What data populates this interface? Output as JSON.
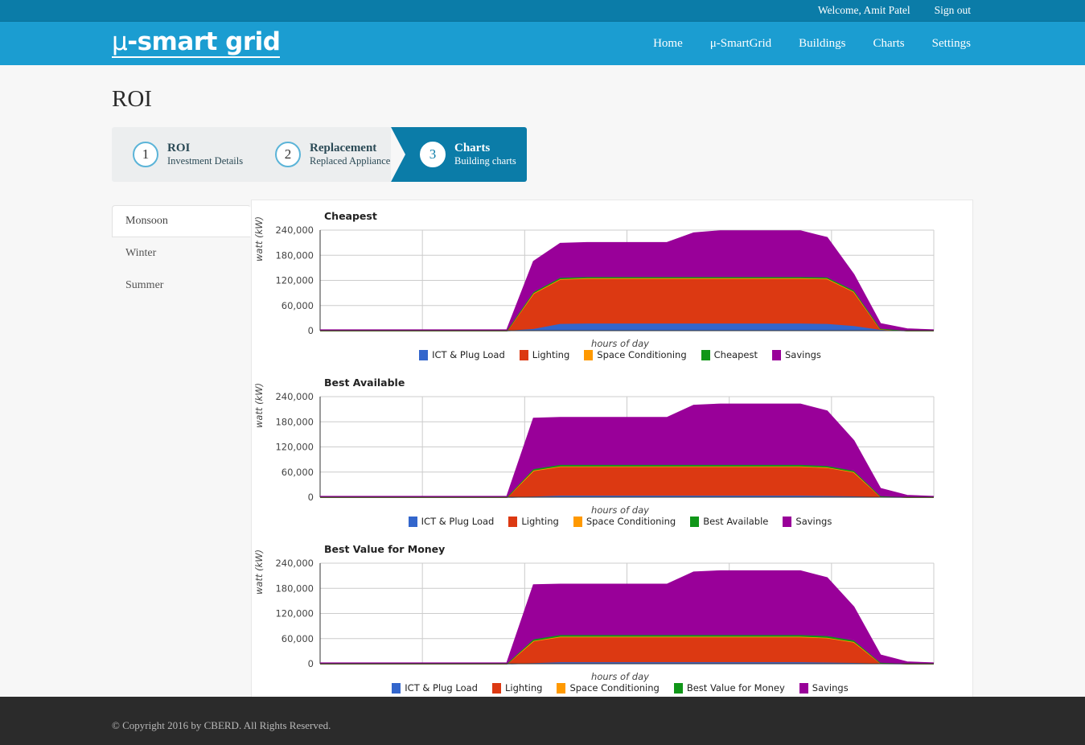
{
  "topbar": {
    "welcome": "Welcome, Amit Patel",
    "signout": "Sign out"
  },
  "brand": {
    "mu": "μ",
    "rest": "-smart grid"
  },
  "nav": [
    {
      "label": "Home"
    },
    {
      "label": "μ-SmartGrid"
    },
    {
      "label": "Buildings"
    },
    {
      "label": "Charts"
    },
    {
      "label": "Settings"
    }
  ],
  "page": {
    "title": "ROI"
  },
  "wizard": [
    {
      "num": "1",
      "title": "ROI",
      "sub": "Investment Details",
      "active": false
    },
    {
      "num": "2",
      "title": "Replacement",
      "sub": "Replaced Appliance",
      "active": false
    },
    {
      "num": "3",
      "title": "Charts",
      "sub": "Building charts",
      "active": true
    }
  ],
  "season_tabs": [
    {
      "label": "Monsoon",
      "active": true
    },
    {
      "label": "Winter",
      "active": false
    },
    {
      "label": "Summer",
      "active": false
    }
  ],
  "colors": {
    "ict": "#3366cc",
    "lighting": "#dc3912",
    "space": "#ff9900",
    "baseline": "#109618",
    "savings": "#990099",
    "brand_blue": "#1b9dd1",
    "accent_teal": "#0b7ca8",
    "footer_dark": "#2b2b2b"
  },
  "footer": {
    "copyright": "© Copyright 2016 by CBERD. All Rights Reserved."
  },
  "chart_data": [
    {
      "type": "area",
      "title": "Cheapest",
      "xlabel": "hours of day",
      "ylabel": "watt (kW)",
      "ylim": [
        0,
        240000
      ],
      "yticks": [
        "0",
        "60,000",
        "120,000",
        "180,000",
        "240,000"
      ],
      "grid": true,
      "legend_position": "bottom",
      "x": [
        0,
        1,
        2,
        3,
        4,
        5,
        6,
        7,
        8,
        9,
        10,
        11,
        12,
        13,
        14,
        15,
        16,
        17,
        18,
        19,
        20,
        21,
        22,
        23
      ],
      "legend": [
        "ICT & Plug Load",
        "Lighting",
        "Space Conditioning",
        "Cheapest",
        "Savings"
      ],
      "series": [
        {
          "name": "ICT & Plug Load",
          "color": "#3366cc",
          "values": [
            0,
            0,
            0,
            0,
            0,
            0,
            0,
            0,
            4000,
            16000,
            17000,
            17000,
            17000,
            17000,
            17000,
            17000,
            17000,
            17000,
            17000,
            16000,
            11000,
            2000,
            0,
            0
          ]
        },
        {
          "name": "Lighting",
          "color": "#dc3912",
          "values": [
            0,
            0,
            0,
            0,
            0,
            0,
            0,
            0,
            85000,
            107000,
            108000,
            108000,
            108000,
            108000,
            108000,
            108000,
            108000,
            108000,
            108000,
            108000,
            82000,
            2000,
            0,
            0
          ]
        },
        {
          "name": "Space Conditioning",
          "color": "#ff9900",
          "values": [
            0,
            0,
            0,
            0,
            0,
            0,
            0,
            0,
            0,
            0,
            0,
            0,
            0,
            0,
            0,
            0,
            0,
            0,
            0,
            0,
            0,
            0,
            0,
            0
          ]
        },
        {
          "name": "Cheapest",
          "color": "#109618",
          "values": [
            0,
            0,
            0,
            0,
            0,
            0,
            0,
            0,
            3000,
            3000,
            3000,
            3000,
            3000,
            3000,
            3000,
            3000,
            3000,
            3000,
            3000,
            3000,
            3000,
            500,
            0,
            0
          ]
        },
        {
          "name": "Savings",
          "color": "#990099",
          "values": [
            1500,
            1500,
            1500,
            1500,
            1500,
            1500,
            1500,
            1500,
            73000,
            82000,
            82000,
            82000,
            82000,
            82000,
            105000,
            110000,
            110000,
            110000,
            110000,
            95000,
            38000,
            12000,
            4000,
            1500
          ]
        }
      ]
    },
    {
      "type": "area",
      "title": "Best Available",
      "xlabel": "hours of day",
      "ylabel": "watt (kW)",
      "ylim": [
        0,
        240000
      ],
      "yticks": [
        "0",
        "60,000",
        "120,000",
        "180,000",
        "240,000"
      ],
      "grid": true,
      "legend_position": "bottom",
      "x": [
        0,
        1,
        2,
        3,
        4,
        5,
        6,
        7,
        8,
        9,
        10,
        11,
        12,
        13,
        14,
        15,
        16,
        17,
        18,
        19,
        20,
        21,
        22,
        23
      ],
      "legend": [
        "ICT & Plug Load",
        "Lighting",
        "Space Conditioning",
        "Best Available",
        "Savings"
      ],
      "series": [
        {
          "name": "ICT & Plug Load",
          "color": "#3366cc",
          "values": [
            0,
            0,
            0,
            0,
            0,
            0,
            0,
            0,
            1500,
            3500,
            3500,
            3500,
            3500,
            3500,
            3500,
            3500,
            3500,
            3500,
            3500,
            3000,
            2000,
            500,
            0,
            0
          ]
        },
        {
          "name": "Lighting",
          "color": "#dc3912",
          "values": [
            0,
            0,
            0,
            0,
            0,
            0,
            0,
            0,
            62000,
            70000,
            70000,
            70000,
            70000,
            70000,
            70000,
            70000,
            70000,
            70000,
            70000,
            68000,
            58000,
            1500,
            0,
            0
          ]
        },
        {
          "name": "Space Conditioning",
          "color": "#ff9900",
          "values": [
            0,
            0,
            0,
            0,
            0,
            0,
            0,
            0,
            0,
            0,
            0,
            0,
            0,
            0,
            0,
            0,
            0,
            0,
            0,
            0,
            0,
            0,
            0,
            0
          ]
        },
        {
          "name": "Best Available",
          "color": "#109618",
          "values": [
            0,
            0,
            0,
            0,
            0,
            0,
            0,
            0,
            3500,
            3500,
            3500,
            3500,
            3500,
            3500,
            3500,
            3500,
            3500,
            3500,
            3500,
            3500,
            3000,
            500,
            0,
            0
          ]
        },
        {
          "name": "Savings",
          "color": "#990099",
          "values": [
            1500,
            1500,
            1500,
            1500,
            1500,
            1500,
            1500,
            1500,
            121000,
            113000,
            113000,
            113000,
            113000,
            113000,
            142000,
            145000,
            145000,
            145000,
            145000,
            131000,
            72000,
            18000,
            4000,
            1500
          ]
        }
      ]
    },
    {
      "type": "area",
      "title": "Best Value for Money",
      "xlabel": "hours of day",
      "ylabel": "watt (kW)",
      "ylim": [
        0,
        240000
      ],
      "yticks": [
        "0",
        "60,000",
        "120,000",
        "180,000",
        "240,000"
      ],
      "grid": true,
      "legend_position": "bottom",
      "x": [
        0,
        1,
        2,
        3,
        4,
        5,
        6,
        7,
        8,
        9,
        10,
        11,
        12,
        13,
        14,
        15,
        16,
        17,
        18,
        19,
        20,
        21,
        22,
        23
      ],
      "legend": [
        "ICT & Plug Load",
        "Lighting",
        "Space Conditioning",
        "Best Value for Money",
        "Savings"
      ],
      "series": [
        {
          "name": "ICT & Plug Load",
          "color": "#3366cc",
          "values": [
            0,
            0,
            0,
            0,
            0,
            0,
            0,
            0,
            1500,
            3500,
            3500,
            3500,
            3500,
            3500,
            3500,
            3500,
            3500,
            3500,
            3500,
            3000,
            2000,
            500,
            0,
            0
          ]
        },
        {
          "name": "Lighting",
          "color": "#dc3912",
          "values": [
            0,
            0,
            0,
            0,
            0,
            0,
            0,
            0,
            53000,
            61000,
            61000,
            61000,
            61000,
            61000,
            61000,
            61000,
            61000,
            61000,
            61000,
            59000,
            50000,
            1500,
            0,
            0
          ]
        },
        {
          "name": "Space Conditioning",
          "color": "#ff9900",
          "values": [
            0,
            0,
            0,
            0,
            0,
            0,
            0,
            0,
            0,
            0,
            0,
            0,
            0,
            0,
            0,
            0,
            0,
            0,
            0,
            0,
            0,
            0,
            0,
            0
          ]
        },
        {
          "name": "Best Value for Money",
          "color": "#109618",
          "values": [
            0,
            0,
            0,
            0,
            0,
            0,
            0,
            0,
            3500,
            4000,
            4000,
            4000,
            4000,
            4000,
            4000,
            4000,
            4000,
            4000,
            4000,
            4000,
            3500,
            500,
            0,
            0
          ]
        },
        {
          "name": "Savings",
          "color": "#990099",
          "values": [
            1500,
            1500,
            1500,
            1500,
            1500,
            1500,
            1500,
            1500,
            130000,
            121000,
            121000,
            121000,
            121000,
            121000,
            150000,
            153000,
            153000,
            153000,
            153000,
            139000,
            80000,
            18000,
            4000,
            1500
          ]
        }
      ]
    }
  ]
}
